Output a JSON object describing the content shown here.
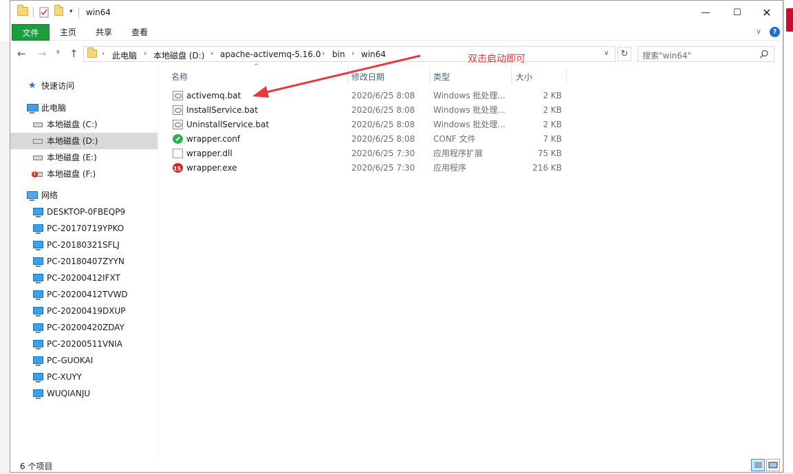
{
  "window": {
    "title": "win64"
  },
  "ribbon": {
    "tabs": [
      "文件",
      "主页",
      "共享",
      "查看"
    ]
  },
  "address": {
    "crumbs": [
      "此电脑",
      "本地磁盘 (D:)",
      "apache-activemq-5.16.0",
      "bin",
      "win64"
    ],
    "search_placeholder": "搜索\"win64\""
  },
  "nav": {
    "quick_access": "快速访问",
    "this_pc": "此电脑",
    "drives": [
      "本地磁盘 (C:)",
      "本地磁盘 (D:)",
      "本地磁盘 (E:)",
      "本地磁盘 (F:)"
    ],
    "network": "网络",
    "computers": [
      "DESKTOP-0FBEQP9",
      "PC-20170719YPKO",
      "PC-20180321SFLJ",
      "PC-20180407ZYYN",
      "PC-20200412IFXT",
      "PC-20200412TVWD",
      "PC-20200419DXUP",
      "PC-20200420ZDAY",
      "PC-20200511VNIA",
      "PC-GUOKAI",
      "PC-XUYY",
      "WUQIANJU"
    ]
  },
  "columns": {
    "name": "名称",
    "date": "修改日期",
    "type": "类型",
    "size": "大小"
  },
  "files": [
    {
      "name": "activemq.bat",
      "date": "2020/6/25 8:08",
      "type": "Windows 批处理...",
      "size": "2 KB",
      "icon": "bat-file-icon"
    },
    {
      "name": "InstallService.bat",
      "date": "2020/6/25 8:08",
      "type": "Windows 批处理...",
      "size": "2 KB",
      "icon": "bat-file-icon"
    },
    {
      "name": "UninstallService.bat",
      "date": "2020/6/25 8:08",
      "type": "Windows 批处理...",
      "size": "2 KB",
      "icon": "bat-file-icon"
    },
    {
      "name": "wrapper.conf",
      "date": "2020/6/25 8:08",
      "type": "CONF 文件",
      "size": "7 KB",
      "icon": "conf-file-icon"
    },
    {
      "name": "wrapper.dll",
      "date": "2020/6/25 7:30",
      "type": "应用程序扩展",
      "size": "75 KB",
      "icon": "dll-file-icon"
    },
    {
      "name": "wrapper.exe",
      "date": "2020/6/25 7:30",
      "type": "应用程序",
      "size": "216 KB",
      "icon": "exe-file-icon"
    }
  ],
  "annotation": "双击启动即可",
  "status": {
    "count": "6 个项目"
  },
  "colors": {
    "file_tab": "#19a03c",
    "annotation": "#e8383d",
    "selected_nav": "#d9d9d9"
  }
}
